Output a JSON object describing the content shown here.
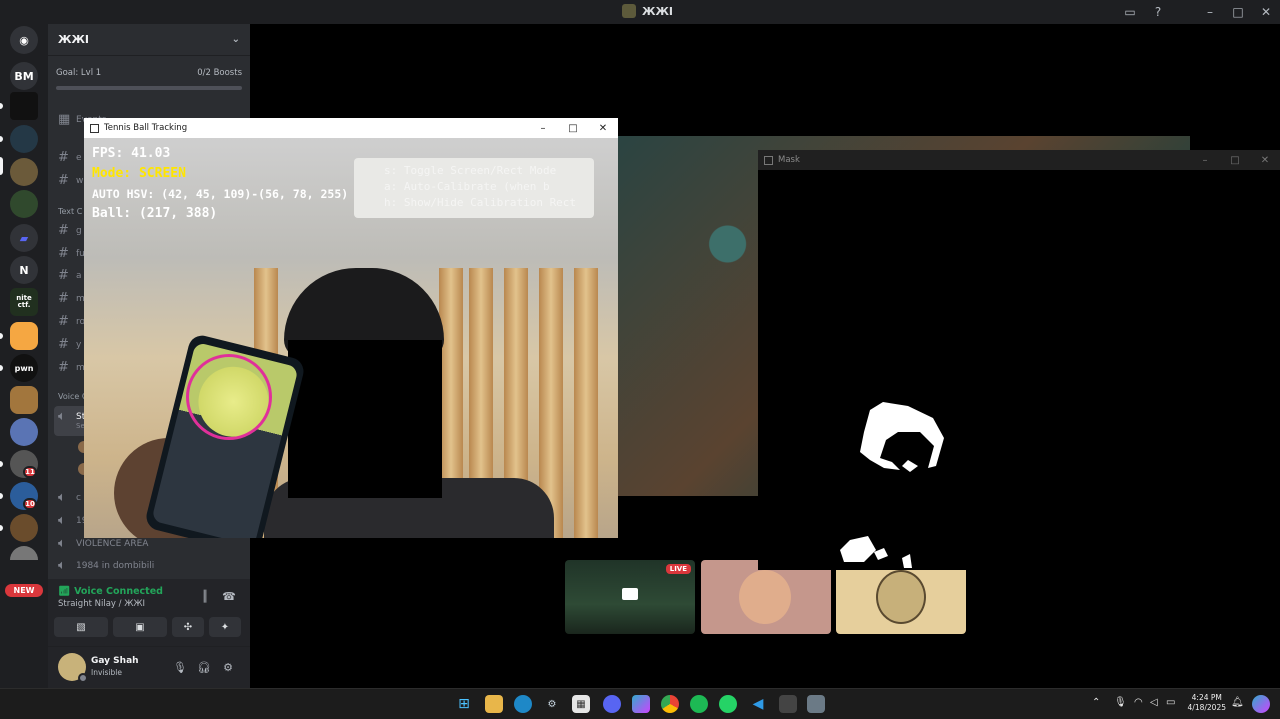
{
  "window": {
    "title": "ЖЖI"
  },
  "rail": {
    "servers": [
      {
        "label": "BM"
      },
      {
        "label": "N"
      },
      {
        "label": "nite ctf."
      },
      {
        "label": "pwn"
      }
    ],
    "badges": [
      "11",
      "10"
    ],
    "new_label": "NEW"
  },
  "sidebar": {
    "guild_name": "ЖЖI",
    "boost_goal": "Goal: Lvl 1",
    "boost_count": "0/2 Boosts",
    "events_label": "Events",
    "category_text": "Text C",
    "category_voice": "Voice C",
    "text_channels": [
      "e",
      "w",
      "g",
      "fu",
      "a",
      "m",
      "ro",
      "y",
      "m"
    ],
    "selected_voice": "St",
    "selected_voice_sub": "Se",
    "voice_channels": [
      "c",
      "19",
      "VIOLENCE AREA",
      "1984 in dombibili"
    ]
  },
  "voice": {
    "status": "Voice Connected",
    "location": "Straight Nilay / ЖЖI"
  },
  "user": {
    "name": "Gay Shah",
    "status": "Invisible"
  },
  "stage": {
    "live_label": "LIVE"
  },
  "tracking": {
    "window_title": "Tennis Ball Tracking",
    "fps": "FPS: 41.03",
    "mode_prefix": "Mode: ",
    "mode_value": "SCREEN",
    "hsv": "AUTO HSV: (42, 45, 109)-(56, 78, 255)",
    "ball": "Ball: (217, 388)",
    "hint1": "s: Toggle Screen/Rect Mode",
    "hint2": "a: Auto-Calibrate (when b",
    "hint3": "h: Show/Hide Calibration Rect",
    "colors": {
      "mode": "#ffe600",
      "ring": "#e0309a"
    }
  },
  "mask": {
    "window_title": "Mask"
  },
  "taskbar": {
    "time": "4:24 PM",
    "date": "4/18/2025"
  },
  "colors": {
    "discord_bg": "#2b2d31",
    "voice_green": "#23a55a",
    "live_red": "#da373c"
  }
}
